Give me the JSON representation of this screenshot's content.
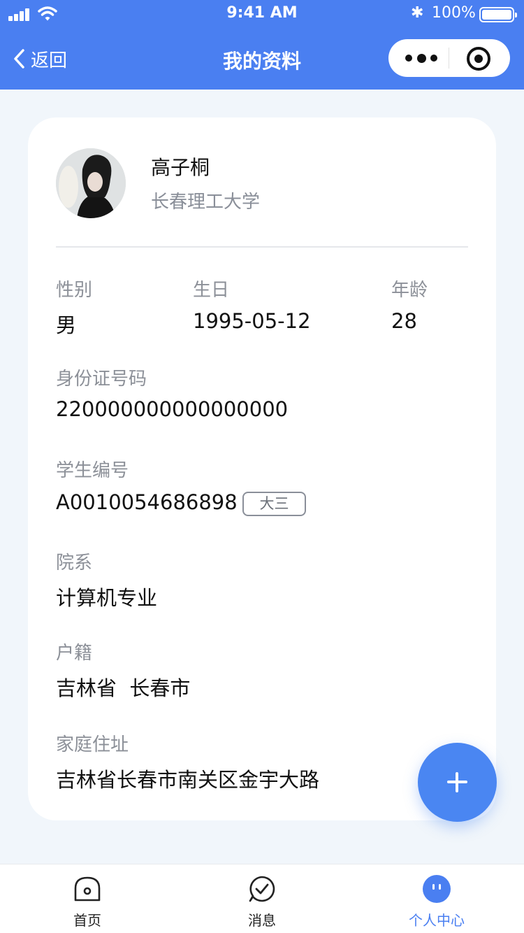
{
  "status_bar": {
    "time": "9:41 AM",
    "battery": "100%"
  },
  "nav": {
    "back_label": "返回",
    "title": "我的资料"
  },
  "profile": {
    "name": "高子桐",
    "school": "长春理工大学"
  },
  "fields": {
    "gender": {
      "label": "性别",
      "value": "男"
    },
    "birthday": {
      "label": "生日",
      "value": "1995-05-12"
    },
    "age": {
      "label": "年龄",
      "value": "28"
    },
    "id_number": {
      "label": "身份证号码",
      "value": "220000000000000000"
    },
    "student_no": {
      "label": "学生编号",
      "value": "A0010054686898",
      "tag": "大三"
    },
    "department": {
      "label": "院系",
      "value": "计算机专业"
    },
    "household": {
      "label": "户籍",
      "value": "吉林省  长春市"
    },
    "address": {
      "label": "家庭住址",
      "value": "吉林省长春市南关区金宇大路"
    }
  },
  "tabbar": {
    "items": [
      {
        "label": "首页",
        "icon": "home-icon"
      },
      {
        "label": "消息",
        "icon": "message-check-icon"
      },
      {
        "label": "个人中心",
        "icon": "profile-face-icon"
      }
    ],
    "active": 2
  },
  "colors": {
    "primary": "#4a7ff1",
    "background": "#f1f6fb",
    "label": "#8c9098"
  }
}
